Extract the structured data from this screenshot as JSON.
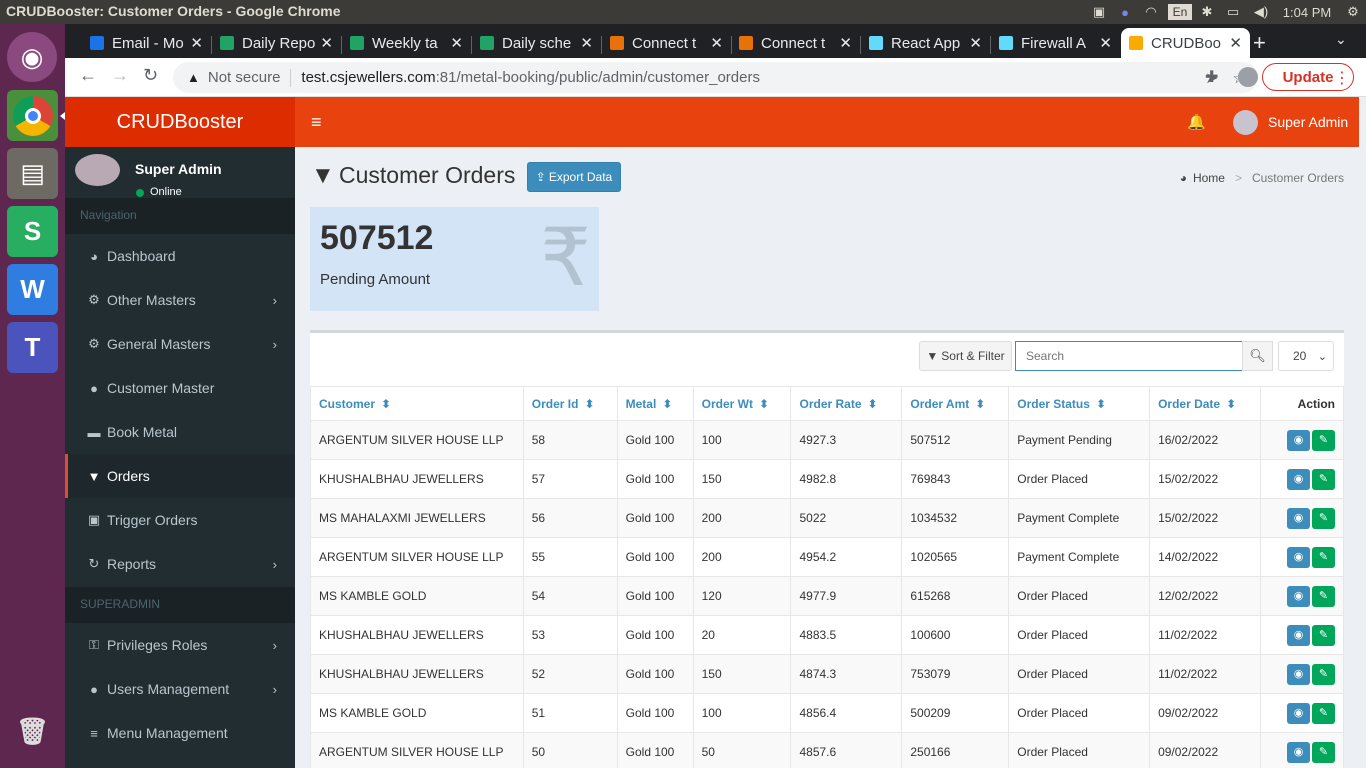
{
  "os": {
    "window_title": "CRUDBooster: Customer Orders - Google Chrome",
    "lang": "En",
    "clock": "1:04 PM"
  },
  "browser": {
    "tabs": [
      {
        "label": "Email - Mo",
        "icon_color": "#1a73e8"
      },
      {
        "label": "Daily Repo",
        "icon_color": "#21a366"
      },
      {
        "label": "Weekly ta",
        "icon_color": "#21a366"
      },
      {
        "label": "Daily sche",
        "icon_color": "#21a366"
      },
      {
        "label": "Connect t",
        "icon_color": "#e8710a"
      },
      {
        "label": "Connect t",
        "icon_color": "#e8710a"
      },
      {
        "label": "React App",
        "icon_color": "#61dafb"
      },
      {
        "label": "Firewall A",
        "icon_color": "#61dafb"
      },
      {
        "label": "CRUDBoo",
        "icon_color": "#f9ab00"
      }
    ],
    "security_label": "Not secure",
    "url_host": "test.csjewellers.com",
    "url_rest": ":81/metal-booking/public/admin/customer_orders",
    "update_label": "Update"
  },
  "app": {
    "logo": "CRUDBooster",
    "user_name": "Super Admin",
    "user_status": "Online",
    "header_user": "Super Admin",
    "nav_header": "Navigation",
    "superadmin_header": "SUPERADMIN",
    "nav_items": [
      {
        "label": "Dashboard",
        "icon": "dashboard-icon",
        "glyph": "◕"
      },
      {
        "label": "Other Masters",
        "icon": "cogs-icon",
        "glyph": "⚙"
      },
      {
        "label": "General Masters",
        "icon": "cogs-icon",
        "glyph": "⚙"
      },
      {
        "label": "Customer Master",
        "icon": "user-icon",
        "glyph": "●"
      },
      {
        "label": "Book Metal",
        "icon": "book-icon",
        "glyph": "▬"
      },
      {
        "label": "Orders",
        "icon": "filter-icon",
        "glyph": "▼"
      },
      {
        "label": "Trigger Orders",
        "icon": "trigger-icon",
        "glyph": "▣"
      },
      {
        "label": "Reports",
        "icon": "refresh-icon",
        "glyph": "↻"
      }
    ],
    "admin_items": [
      {
        "label": "Privileges Roles",
        "icon": "key-icon",
        "glyph": "⚿"
      },
      {
        "label": "Users Management",
        "icon": "users-icon",
        "glyph": "●"
      },
      {
        "label": "Menu Management",
        "icon": "bars-icon",
        "glyph": "≡"
      }
    ]
  },
  "page": {
    "title": "Customer Orders",
    "export_label": "Export Data",
    "breadcrumb_home": "Home",
    "breadcrumb_current": "Customer Orders",
    "stat_value": "507512",
    "stat_label": "Pending Amount",
    "sort_filter_label": "Sort & Filter",
    "search_placeholder": "Search",
    "page_size": "20",
    "action_header": "Action"
  },
  "table": {
    "columns": [
      "Customer",
      "Order Id",
      "Metal",
      "Order Wt",
      "Order Rate",
      "Order Amt",
      "Order Status",
      "Order Date"
    ],
    "rows": [
      [
        "ARGENTUM SILVER HOUSE LLP",
        "58",
        "Gold 100",
        "100",
        "4927.3",
        "507512",
        "Payment Pending",
        "16/02/2022"
      ],
      [
        "KHUSHALBHAU JEWELLERS",
        "57",
        "Gold 100",
        "150",
        "4982.8",
        "769843",
        "Order Placed",
        "15/02/2022"
      ],
      [
        "MS MAHALAXMI JEWELLERS",
        "56",
        "Gold 100",
        "200",
        "5022",
        "1034532",
        "Payment Complete",
        "15/02/2022"
      ],
      [
        "ARGENTUM SILVER HOUSE LLP",
        "55",
        "Gold 100",
        "200",
        "4954.2",
        "1020565",
        "Payment Complete",
        "14/02/2022"
      ],
      [
        "MS KAMBLE GOLD",
        "54",
        "Gold 100",
        "120",
        "4977.9",
        "615268",
        "Order Placed",
        "12/02/2022"
      ],
      [
        "KHUSHALBHAU JEWELLERS",
        "53",
        "Gold 100",
        "20",
        "4883.5",
        "100600",
        "Order Placed",
        "11/02/2022"
      ],
      [
        "KHUSHALBHAU JEWELLERS",
        "52",
        "Gold 100",
        "150",
        "4874.3",
        "753079",
        "Order Placed",
        "11/02/2022"
      ],
      [
        "MS KAMBLE GOLD",
        "51",
        "Gold 100",
        "100",
        "4856.4",
        "500209",
        "Order Placed",
        "09/02/2022"
      ],
      [
        "ARGENTUM SILVER HOUSE LLP",
        "50",
        "Gold 100",
        "50",
        "4857.6",
        "250166",
        "Order Placed",
        "09/02/2022"
      ]
    ]
  }
}
